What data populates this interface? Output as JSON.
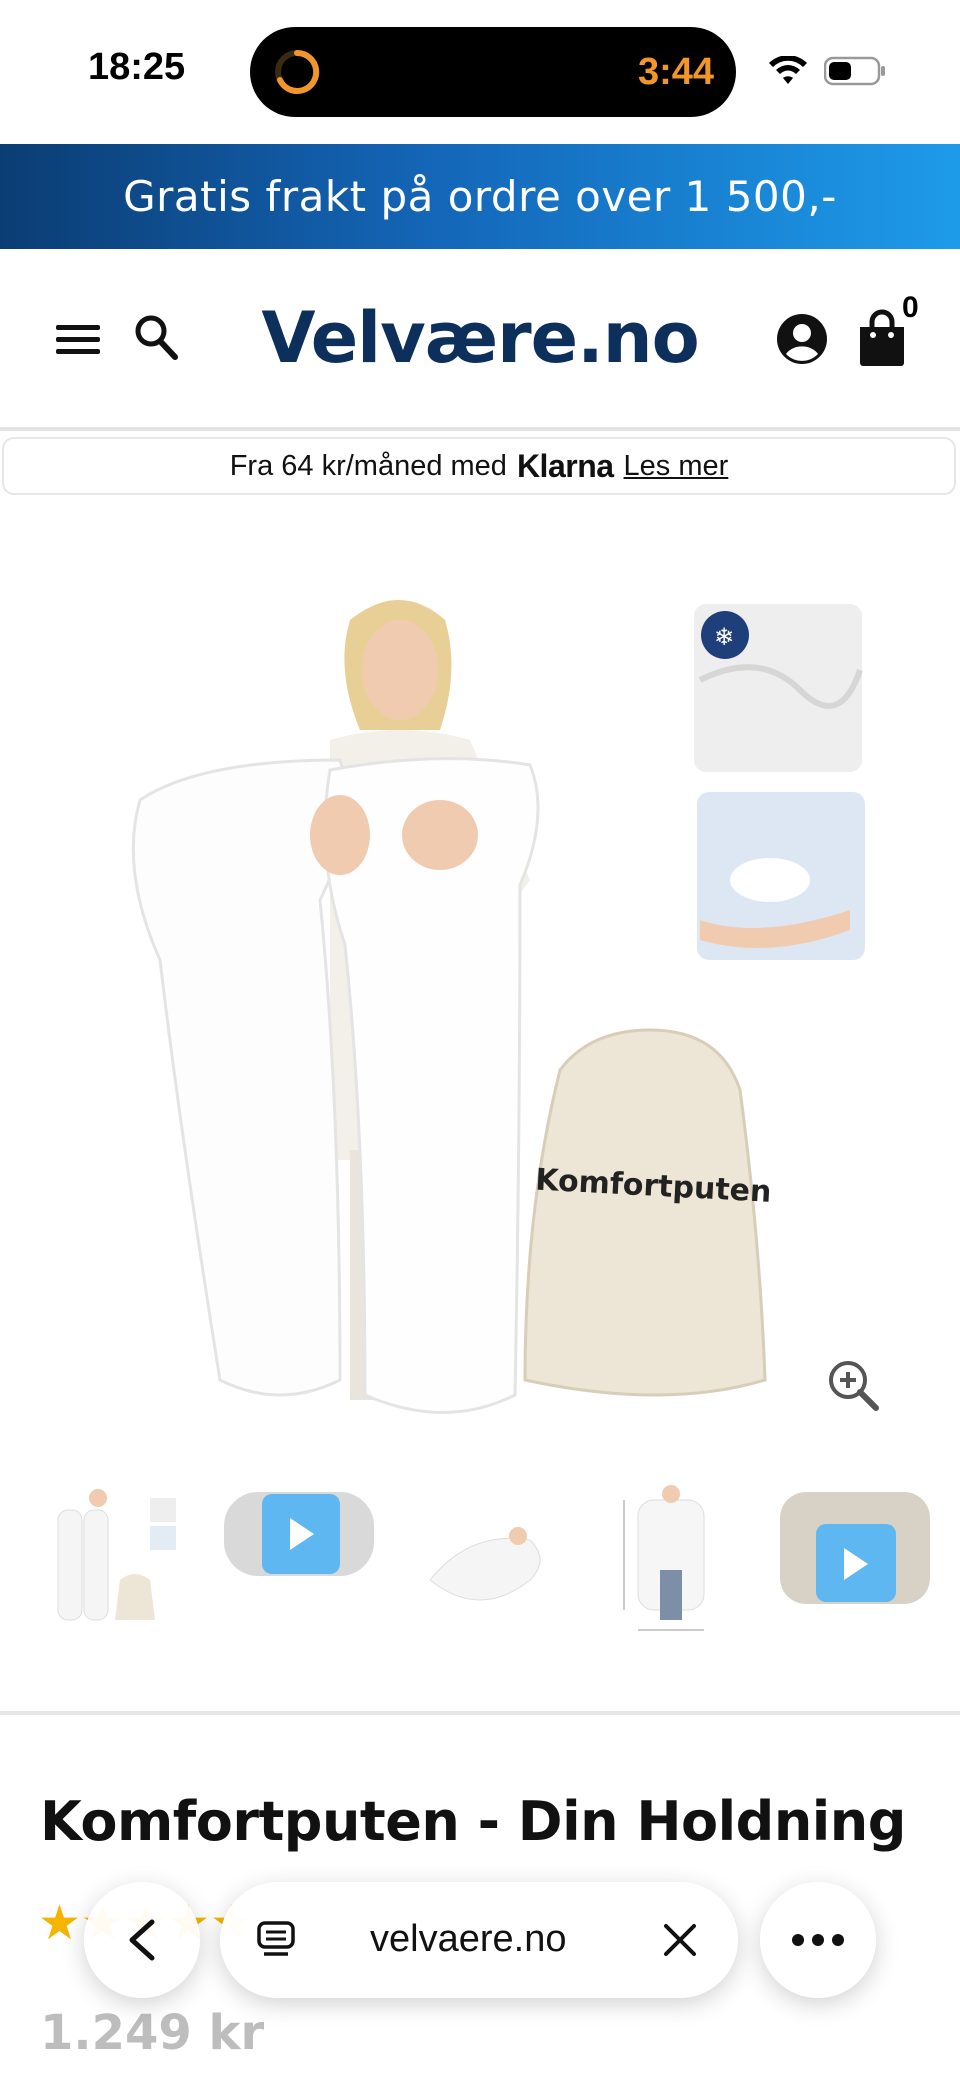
{
  "status": {
    "time": "18:25",
    "timer": "3:44"
  },
  "promo": {
    "text": "Gratis frakt på ordre over 1 500,-"
  },
  "header": {
    "logo": "Velvære.no",
    "cart_count": "0"
  },
  "klarna": {
    "prefix": "Fra 64 kr/måned med",
    "brand": "Klarna",
    "link": "Les mer"
  },
  "product": {
    "bag_label": "Komfortputen",
    "title": "Komfortputen - Din Holdning",
    "rating_stars": "★★★★★",
    "price": "1.249 kr"
  },
  "browser": {
    "url": "velvaere.no"
  },
  "colors": {
    "promo_start": "#0b3d73",
    "promo_end": "#1d9be9",
    "logo": "#0d2f5b",
    "star": "#f4b400",
    "video_play": "#5fb7f2"
  }
}
